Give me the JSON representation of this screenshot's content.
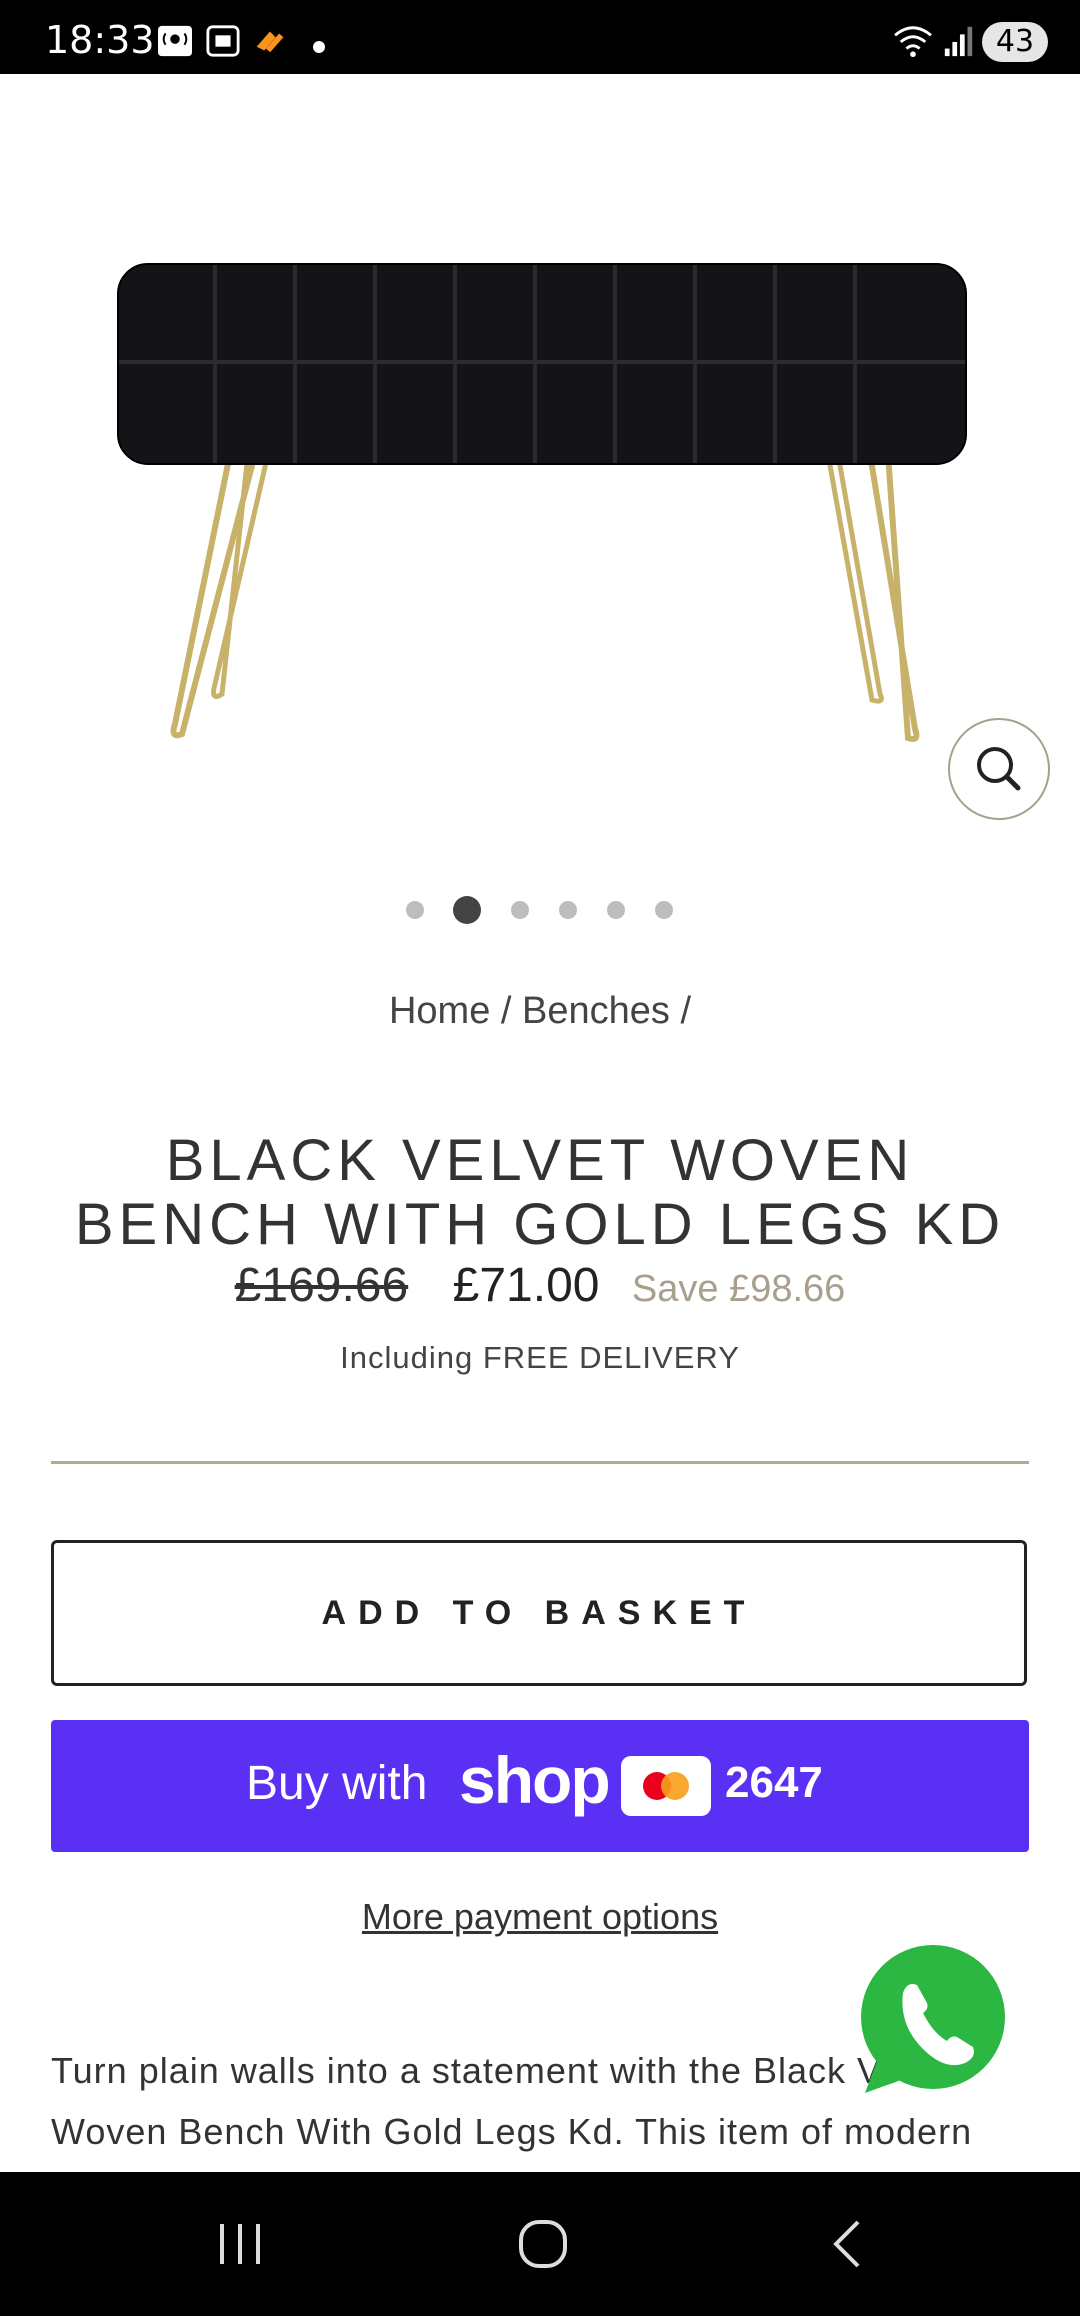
{
  "status_bar": {
    "time": "18:33",
    "battery": "43",
    "icons": [
      "podcast-icon",
      "screenshot-icon",
      "app-icon",
      "dot-icon",
      "wifi-icon",
      "signal-icon"
    ]
  },
  "product": {
    "image_alt": "black-velvet-woven-bench-image",
    "gallery_count": 6,
    "gallery_active_index": 1,
    "breadcrumb": "Home / Benches /",
    "title": "BLACK VELVET WOVEN BENCH WITH GOLD LEGS KD",
    "old_price": "£169.66",
    "price": "£71.00",
    "save": "Save £98.66",
    "delivery": "Including FREE DELIVERY",
    "description": "Turn plain walls into a statement with the Black Velvet Woven Bench With Gold Legs Kd. This item of modern"
  },
  "actions": {
    "add_to_basket": "ADD TO BASKET",
    "buy_with": "Buy with",
    "shop_word": "shop",
    "card_number": "2647",
    "more_payment": "More payment options"
  },
  "colors": {
    "shop_purple": "#5a31f4",
    "accent_tan": "#a89f8c",
    "whatsapp_green": "#2bb741"
  }
}
